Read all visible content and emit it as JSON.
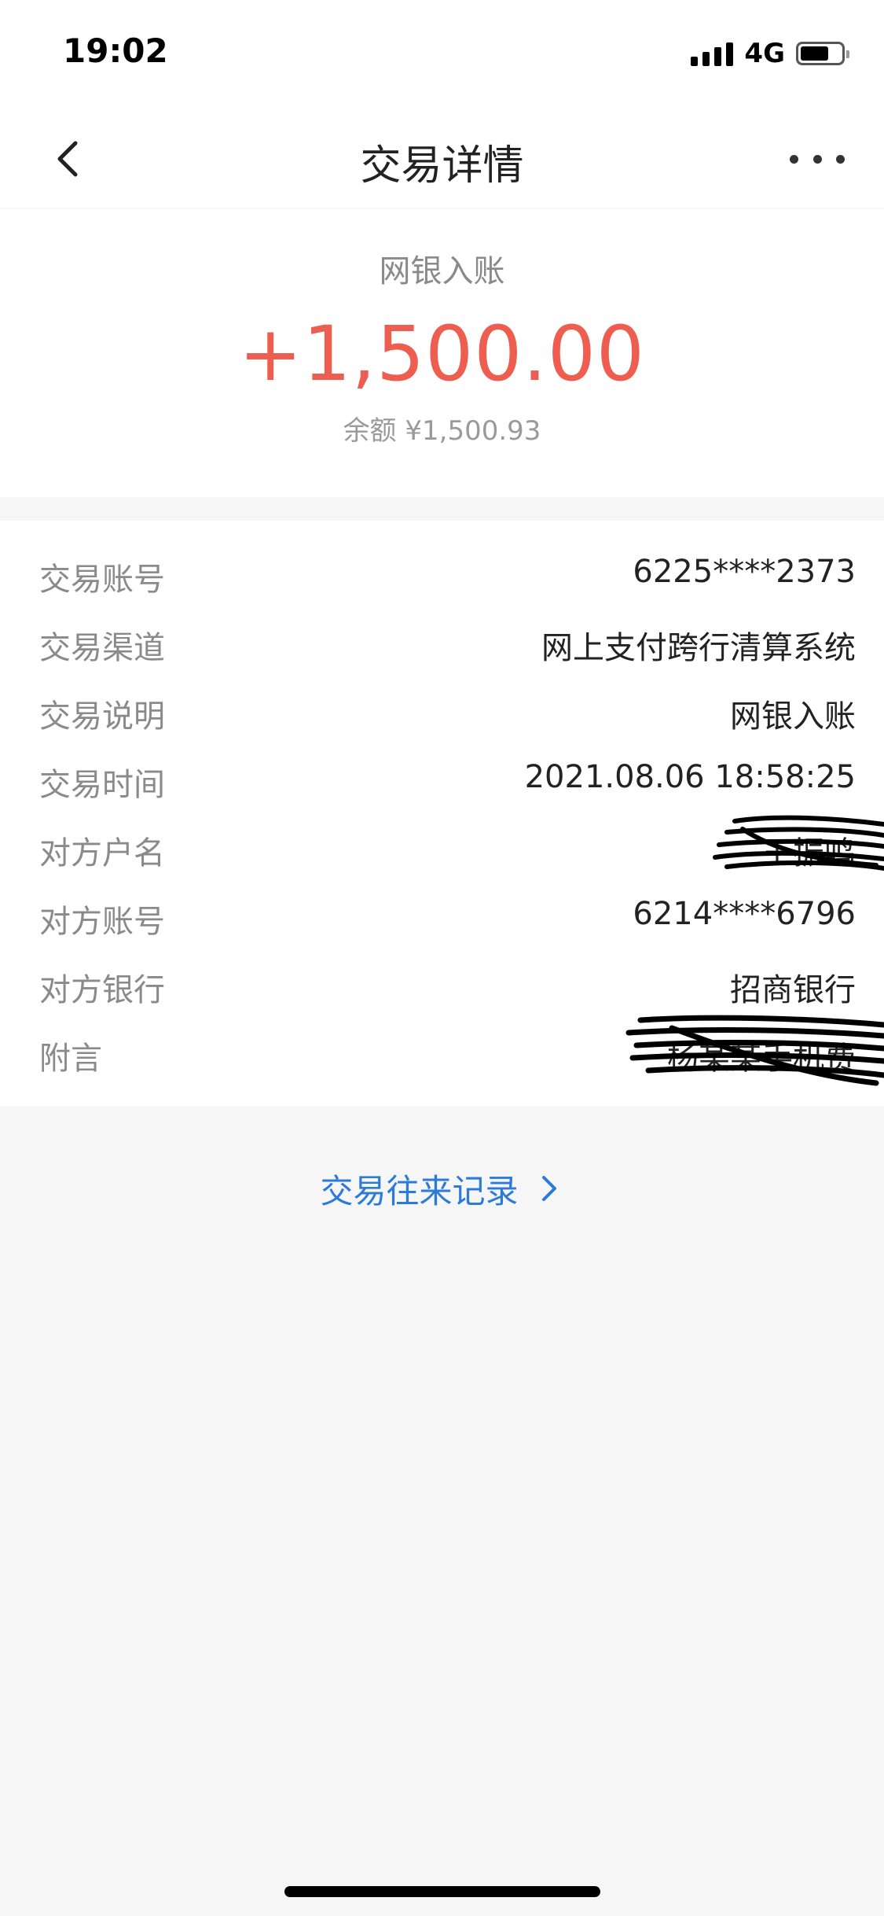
{
  "status_bar": {
    "time": "19:02",
    "network": "4G",
    "battery_level": 0.7
  },
  "nav": {
    "title": "交易详情",
    "back_icon": "chevron-left-icon",
    "more_icon": "more-dots-icon"
  },
  "summary": {
    "label": "网银入账",
    "amount": "+1,500.00",
    "balance": "余额 ¥1,500.93",
    "amount_color": "#ee5e50"
  },
  "details": {
    "rows": [
      {
        "label": "交易账号",
        "value": "6225****2373"
      },
      {
        "label": "交易渠道",
        "value": "网上支付跨行清算系统"
      },
      {
        "label": "交易说明",
        "value": "网银入账"
      },
      {
        "label": "交易时间",
        "value": "2021.08.06 18:58:25"
      },
      {
        "label": "对方户名",
        "value": "王振鸣"
      },
      {
        "label": "对方账号",
        "value": "6214****6796"
      },
      {
        "label": "对方银行",
        "value": "招商银行"
      },
      {
        "label": "附言",
        "value": "杨某某手机费"
      }
    ]
  },
  "records_link": {
    "label": "交易往来记录",
    "icon": "chevron-right-icon",
    "color": "#2d7bd8"
  }
}
